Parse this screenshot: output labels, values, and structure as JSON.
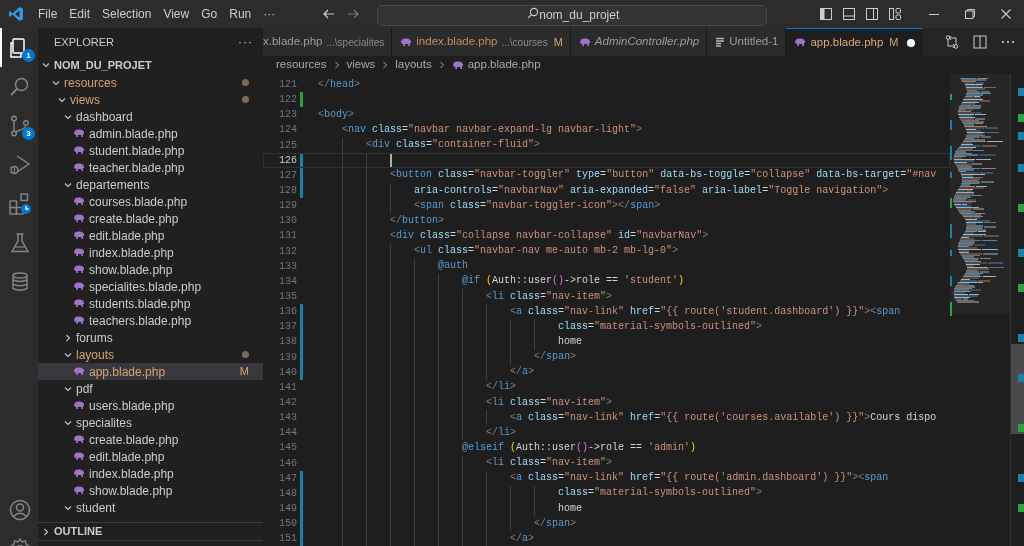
{
  "title_bar": {
    "menu": [
      "File",
      "Edit",
      "Selection",
      "View",
      "Go",
      "Run",
      "···"
    ],
    "search": {
      "value": "nom_du_projet"
    }
  },
  "activity_bar": {
    "top": [
      {
        "selected": true,
        "badge": "1"
      },
      {
        "selected": false
      },
      {
        "selected": false,
        "badge": "3"
      },
      {
        "selected": false
      },
      {
        "selected": false
      },
      {
        "selected": false
      },
      {
        "selected": false
      }
    ],
    "bottom": [
      {
        "selected": false
      },
      {
        "selected": false
      }
    ]
  },
  "sidebar": {
    "title": "EXPLORER",
    "more": "···",
    "project": {
      "label": "NOM_DU_PROJET",
      "expanded": true
    },
    "tree": [
      {
        "label": "resources",
        "kind": "folder",
        "expanded": true,
        "modified": true,
        "selected": false,
        "children": [
          {
            "label": "views",
            "kind": "folder",
            "expanded": true,
            "modified": true,
            "selected": false,
            "children": [
              {
                "label": "dashboard",
                "kind": "folder",
                "expanded": true,
                "modified": false,
                "selected": false,
                "children": [
                  {
                    "label": "admin.blade.php",
                    "kind": "file",
                    "modified": false,
                    "selected": false
                  },
                  {
                    "label": "student.blade.php",
                    "kind": "file",
                    "modified": false,
                    "selected": false
                  },
                  {
                    "label": "teacher.blade.php",
                    "kind": "file",
                    "modified": false,
                    "selected": false
                  }
                ]
              },
              {
                "label": "departements",
                "kind": "folder",
                "expanded": true,
                "modified": false,
                "selected": false,
                "children": [
                  {
                    "label": "courses.blade.php",
                    "kind": "file",
                    "modified": false,
                    "selected": false
                  },
                  {
                    "label": "create.blade.php",
                    "kind": "file",
                    "modified": false,
                    "selected": false
                  },
                  {
                    "label": "edit.blade.php",
                    "kind": "file",
                    "modified": false,
                    "selected": false
                  },
                  {
                    "label": "index.blade.php",
                    "kind": "file",
                    "modified": false,
                    "selected": false
                  },
                  {
                    "label": "show.blade.php",
                    "kind": "file",
                    "modified": false,
                    "selected": false
                  },
                  {
                    "label": "specialites.blade.php",
                    "kind": "file",
                    "modified": false,
                    "selected": false
                  },
                  {
                    "label": "students.blade.php",
                    "kind": "file",
                    "modified": false,
                    "selected": false
                  },
                  {
                    "label": "teachers.blade.php",
                    "kind": "file",
                    "modified": false,
                    "selected": false
                  }
                ]
              },
              {
                "label": "forums",
                "kind": "folder",
                "expanded": false,
                "modified": false,
                "selected": false
              },
              {
                "label": "layouts",
                "kind": "folder",
                "expanded": true,
                "modified": true,
                "selected": false,
                "children": [
                  {
                    "label": "app.blade.php",
                    "kind": "file",
                    "modified": true,
                    "status": "M",
                    "selected": true
                  }
                ]
              },
              {
                "label": "pdf",
                "kind": "folder",
                "expanded": true,
                "modified": false,
                "selected": false,
                "children": [
                  {
                    "label": "users.blade.php",
                    "kind": "file",
                    "modified": false,
                    "selected": false
                  }
                ]
              },
              {
                "label": "specialites",
                "kind": "folder",
                "expanded": true,
                "modified": false,
                "selected": false,
                "children": [
                  {
                    "label": "create.blade.php",
                    "kind": "file",
                    "modified": false,
                    "selected": false
                  },
                  {
                    "label": "edit.blade.php",
                    "kind": "file",
                    "modified": false,
                    "selected": false
                  },
                  {
                    "label": "index.blade.php",
                    "kind": "file",
                    "modified": false,
                    "selected": false
                  },
                  {
                    "label": "show.blade.php",
                    "kind": "file",
                    "modified": false,
                    "selected": false
                  }
                ]
              },
              {
                "label": "student",
                "kind": "folder",
                "expanded": true,
                "modified": false,
                "selected": false
              }
            ]
          }
        ]
      }
    ],
    "outline": {
      "label": "OUTLINE",
      "expanded": false
    }
  },
  "tabs": [
    {
      "label": "x.blade.php",
      "path": "...\\specialites",
      "selected": false,
      "preview": false,
      "dirty": false
    },
    {
      "label": "index.blade.php",
      "kind": "blade",
      "path": "...\\courses",
      "status": "M",
      "selected": false,
      "preview": false,
      "dirty": false
    },
    {
      "label": "AdminController.php",
      "kind": "blade",
      "selected": false,
      "preview": true,
      "dirty": false
    },
    {
      "label": "Untitled-1",
      "kind": "text",
      "selected": false,
      "preview": false,
      "dirty": false
    },
    {
      "label": "app.blade.php",
      "kind": "blade",
      "status": "M",
      "selected": true,
      "preview": false,
      "dirty": true
    }
  ],
  "breadcrumbs": [
    {
      "label": "resources"
    },
    {
      "label": "views"
    },
    {
      "label": "layouts"
    },
    {
      "label": "app.blade.php",
      "kind": "blade"
    }
  ],
  "editor": {
    "lines": [
      {
        "number": "121",
        "current": false,
        "tokens": [
          {
            "kind": "punct",
            "text": "</"
          },
          {
            "kind": "tag",
            "text": "head"
          },
          {
            "kind": "punct",
            "text": ">"
          }
        ]
      },
      {
        "number": "122",
        "current": false,
        "change": {
          "kind": "added"
        }
      },
      {
        "number": "123",
        "current": false,
        "tokens": [
          {
            "kind": "punct",
            "text": "<"
          },
          {
            "kind": "tag",
            "text": "body"
          },
          {
            "kind": "punct",
            "text": ">"
          }
        ]
      },
      {
        "number": "124",
        "current": false,
        "tokens": [
          {
            "kind": "punct",
            "text": "    <"
          },
          {
            "kind": "tag",
            "text": "nav "
          },
          {
            "kind": "attr",
            "text": "class"
          },
          {
            "kind": "plain",
            "text": "="
          },
          {
            "kind": "string",
            "text": "\"navbar navbar-expand-lg navbar-light\""
          },
          {
            "kind": "punct",
            "text": ">"
          }
        ]
      },
      {
        "number": "125",
        "current": false,
        "tokens": [
          {
            "kind": "punct",
            "text": "        <"
          },
          {
            "kind": "tag",
            "text": "div "
          },
          {
            "kind": "attr",
            "text": "class"
          },
          {
            "kind": "plain",
            "text": "="
          },
          {
            "kind": "string",
            "text": "\"container-fluid\""
          },
          {
            "kind": "punct",
            "text": ">"
          }
        ]
      },
      {
        "number": "126",
        "current": true,
        "change": {
          "kind": "modified"
        }
      },
      {
        "number": "127",
        "current": false,
        "change": {
          "kind": "modified"
        },
        "tokens": [
          {
            "kind": "punct",
            "text": "            <"
          },
          {
            "kind": "tag",
            "text": "button "
          },
          {
            "kind": "attr",
            "text": "class"
          },
          {
            "kind": "plain",
            "text": "="
          },
          {
            "kind": "string",
            "text": "\"navbar-toggler\" "
          },
          {
            "kind": "attr",
            "text": "type"
          },
          {
            "kind": "plain",
            "text": "="
          },
          {
            "kind": "string",
            "text": "\"button\" "
          },
          {
            "kind": "attr",
            "text": "data-bs-toggle"
          },
          {
            "kind": "plain",
            "text": "="
          },
          {
            "kind": "string",
            "text": "\"collapse\" "
          },
          {
            "kind": "attr",
            "text": "data-bs-target"
          },
          {
            "kind": "plain",
            "text": "="
          },
          {
            "kind": "string",
            "text": "\"#nav"
          }
        ]
      },
      {
        "number": "128",
        "current": false,
        "change": {
          "kind": "modified"
        },
        "tokens": [
          {
            "kind": "attr",
            "text": "                aria-controls"
          },
          {
            "kind": "plain",
            "text": "="
          },
          {
            "kind": "string",
            "text": "\"navbarNav\" "
          },
          {
            "kind": "attr",
            "text": "aria-expanded"
          },
          {
            "kind": "plain",
            "text": "="
          },
          {
            "kind": "string",
            "text": "\"false\" "
          },
          {
            "kind": "attr",
            "text": "aria-label"
          },
          {
            "kind": "plain",
            "text": "="
          },
          {
            "kind": "string",
            "text": "\"Toggle navigation\""
          },
          {
            "kind": "punct",
            "text": ">"
          }
        ]
      },
      {
        "number": "129",
        "current": false,
        "tokens": [
          {
            "kind": "punct",
            "text": "                <"
          },
          {
            "kind": "tag",
            "text": "span "
          },
          {
            "kind": "attr",
            "text": "class"
          },
          {
            "kind": "plain",
            "text": "="
          },
          {
            "kind": "string",
            "text": "\"navbar-toggler-icon\""
          },
          {
            "kind": "punct",
            "text": "></"
          },
          {
            "kind": "tag",
            "text": "span"
          },
          {
            "kind": "punct",
            "text": ">"
          }
        ]
      },
      {
        "number": "130",
        "current": false,
        "tokens": [
          {
            "kind": "punct",
            "text": "            </"
          },
          {
            "kind": "tag",
            "text": "button"
          },
          {
            "kind": "punct",
            "text": ">"
          }
        ]
      },
      {
        "number": "131",
        "current": false,
        "tokens": [
          {
            "kind": "punct",
            "text": "            <"
          },
          {
            "kind": "tag",
            "text": "div "
          },
          {
            "kind": "attr",
            "text": "class"
          },
          {
            "kind": "plain",
            "text": "="
          },
          {
            "kind": "string",
            "text": "\"collapse navbar-collapse\" "
          },
          {
            "kind": "attr",
            "text": "id"
          },
          {
            "kind": "plain",
            "text": "="
          },
          {
            "kind": "string",
            "text": "\"navbarNav\""
          },
          {
            "kind": "punct",
            "text": ">"
          }
        ]
      },
      {
        "number": "132",
        "current": false,
        "tokens": [
          {
            "kind": "punct",
            "text": "                <"
          },
          {
            "kind": "tag",
            "text": "ul "
          },
          {
            "kind": "attr",
            "text": "class"
          },
          {
            "kind": "plain",
            "text": "="
          },
          {
            "kind": "string",
            "text": "\"navbar-nav me-auto mb-2 mb-lg-0\""
          },
          {
            "kind": "punct",
            "text": ">"
          }
        ]
      },
      {
        "number": "133",
        "current": false,
        "tokens": [
          {
            "kind": "directive",
            "text": "                    @auth"
          }
        ]
      },
      {
        "number": "134",
        "current": false,
        "tokens": [
          {
            "kind": "directive",
            "text": "                        @if "
          },
          {
            "kind": "bracket",
            "text": "("
          },
          {
            "kind": "plain",
            "text": "Auth::user"
          },
          {
            "kind": "bracket2",
            "text": "()"
          },
          {
            "kind": "plain",
            "text": "->role == "
          },
          {
            "kind": "string",
            "text": "'student'"
          },
          {
            "kind": "bracket",
            "text": ")"
          }
        ]
      },
      {
        "number": "135",
        "current": false,
        "tokens": [
          {
            "kind": "punct",
            "text": "                            <"
          },
          {
            "kind": "tag",
            "text": "li "
          },
          {
            "kind": "attr",
            "text": "class"
          },
          {
            "kind": "plain",
            "text": "="
          },
          {
            "kind": "string",
            "text": "\"nav-item\""
          },
          {
            "kind": "punct",
            "text": ">"
          }
        ]
      },
      {
        "number": "136",
        "current": false,
        "change": {
          "kind": "modified"
        },
        "tokens": [
          {
            "kind": "punct",
            "text": "                                <"
          },
          {
            "kind": "tag",
            "text": "a "
          },
          {
            "kind": "attr",
            "text": "class"
          },
          {
            "kind": "plain",
            "text": "="
          },
          {
            "kind": "string",
            "text": "\"nav-link\" "
          },
          {
            "kind": "attr",
            "text": "href"
          },
          {
            "kind": "plain",
            "text": "="
          },
          {
            "kind": "string",
            "text": "\"{{ route('student.dashboard') }}\""
          },
          {
            "kind": "punct",
            "text": "><"
          },
          {
            "kind": "tag",
            "text": "span"
          }
        ]
      },
      {
        "number": "137",
        "current": false,
        "change": {
          "kind": "modified"
        },
        "tokens": [
          {
            "kind": "attr",
            "text": "                                        class"
          },
          {
            "kind": "plain",
            "text": "="
          },
          {
            "kind": "string",
            "text": "\"material-symbols-outlined\""
          },
          {
            "kind": "punct",
            "text": ">"
          }
        ]
      },
      {
        "number": "138",
        "current": false,
        "change": {
          "kind": "modified"
        },
        "tokens": [
          {
            "kind": "plain",
            "text": "                                        home"
          }
        ]
      },
      {
        "number": "139",
        "current": false,
        "change": {
          "kind": "modified"
        },
        "tokens": [
          {
            "kind": "punct",
            "text": "                                    </"
          },
          {
            "kind": "tag",
            "text": "span"
          },
          {
            "kind": "punct",
            "text": ">"
          }
        ]
      },
      {
        "number": "140",
        "current": false,
        "change": {
          "kind": "modified"
        },
        "tokens": [
          {
            "kind": "punct",
            "text": "                                </"
          },
          {
            "kind": "tag",
            "text": "a"
          },
          {
            "kind": "punct",
            "text": ">"
          }
        ]
      },
      {
        "number": "141",
        "current": false,
        "tokens": [
          {
            "kind": "punct",
            "text": "                            </"
          },
          {
            "kind": "tag",
            "text": "li"
          },
          {
            "kind": "punct",
            "text": ">"
          }
        ]
      },
      {
        "number": "142",
        "current": false,
        "tokens": [
          {
            "kind": "punct",
            "text": "                            <"
          },
          {
            "kind": "tag",
            "text": "li "
          },
          {
            "kind": "attr",
            "text": "class"
          },
          {
            "kind": "plain",
            "text": "="
          },
          {
            "kind": "string",
            "text": "\"nav-item\""
          },
          {
            "kind": "punct",
            "text": ">"
          }
        ]
      },
      {
        "number": "143",
        "current": false,
        "tokens": [
          {
            "kind": "punct",
            "text": "                                <"
          },
          {
            "kind": "tag",
            "text": "a "
          },
          {
            "kind": "attr",
            "text": "class"
          },
          {
            "kind": "plain",
            "text": "="
          },
          {
            "kind": "string",
            "text": "\"nav-link\" "
          },
          {
            "kind": "attr",
            "text": "href"
          },
          {
            "kind": "plain",
            "text": "="
          },
          {
            "kind": "string",
            "text": "\"{{ route('courses.available') }}\""
          },
          {
            "kind": "punct",
            "text": ">"
          },
          {
            "kind": "plain",
            "text": "Cours dispo"
          }
        ]
      },
      {
        "number": "144",
        "current": false,
        "tokens": [
          {
            "kind": "punct",
            "text": "                            </"
          },
          {
            "kind": "tag",
            "text": "li"
          },
          {
            "kind": "punct",
            "text": ">"
          }
        ]
      },
      {
        "number": "145",
        "current": false,
        "tokens": [
          {
            "kind": "directive",
            "text": "                        @elseif "
          },
          {
            "kind": "bracket",
            "text": "("
          },
          {
            "kind": "plain",
            "text": "Auth::user"
          },
          {
            "kind": "bracket2",
            "text": "()"
          },
          {
            "kind": "plain",
            "text": "->role == "
          },
          {
            "kind": "string",
            "text": "'admin'"
          },
          {
            "kind": "bracket",
            "text": ")"
          }
        ]
      },
      {
        "number": "146",
        "current": false,
        "tokens": [
          {
            "kind": "punct",
            "text": "                            <"
          },
          {
            "kind": "tag",
            "text": "li "
          },
          {
            "kind": "attr",
            "text": "class"
          },
          {
            "kind": "plain",
            "text": "="
          },
          {
            "kind": "string",
            "text": "\"nav-item\""
          },
          {
            "kind": "punct",
            "text": ">"
          }
        ]
      },
      {
        "number": "147",
        "current": false,
        "change": {
          "kind": "modified"
        },
        "tokens": [
          {
            "kind": "punct",
            "text": "                                <"
          },
          {
            "kind": "tag",
            "text": "a "
          },
          {
            "kind": "attr",
            "text": "class"
          },
          {
            "kind": "plain",
            "text": "="
          },
          {
            "kind": "string",
            "text": "\"nav-link\" "
          },
          {
            "kind": "attr",
            "text": "href"
          },
          {
            "kind": "plain",
            "text": "="
          },
          {
            "kind": "string",
            "text": "\"{{ route('admin.dashboard') }}\""
          },
          {
            "kind": "punct",
            "text": "><"
          },
          {
            "kind": "tag",
            "text": "span"
          }
        ]
      },
      {
        "number": "148",
        "current": false,
        "change": {
          "kind": "modified"
        },
        "tokens": [
          {
            "kind": "attr",
            "text": "                                        class"
          },
          {
            "kind": "plain",
            "text": "="
          },
          {
            "kind": "string",
            "text": "\"material-symbols-outlined\""
          },
          {
            "kind": "punct",
            "text": ">"
          }
        ]
      },
      {
        "number": "149",
        "current": false,
        "change": {
          "kind": "modified"
        },
        "tokens": [
          {
            "kind": "plain",
            "text": "                                        home"
          }
        ]
      },
      {
        "number": "150",
        "current": false,
        "change": {
          "kind": "modified"
        },
        "tokens": [
          {
            "kind": "punct",
            "text": "                                    </"
          },
          {
            "kind": "tag",
            "text": "span"
          },
          {
            "kind": "punct",
            "text": ">"
          }
        ]
      },
      {
        "number": "151",
        "current": false,
        "change": {
          "kind": "modified"
        },
        "tokens": [
          {
            "kind": "punct",
            "text": "                                </"
          },
          {
            "kind": "tag",
            "text": "a"
          },
          {
            "kind": "punct",
            "text": ">"
          }
        ]
      }
    ]
  }
}
